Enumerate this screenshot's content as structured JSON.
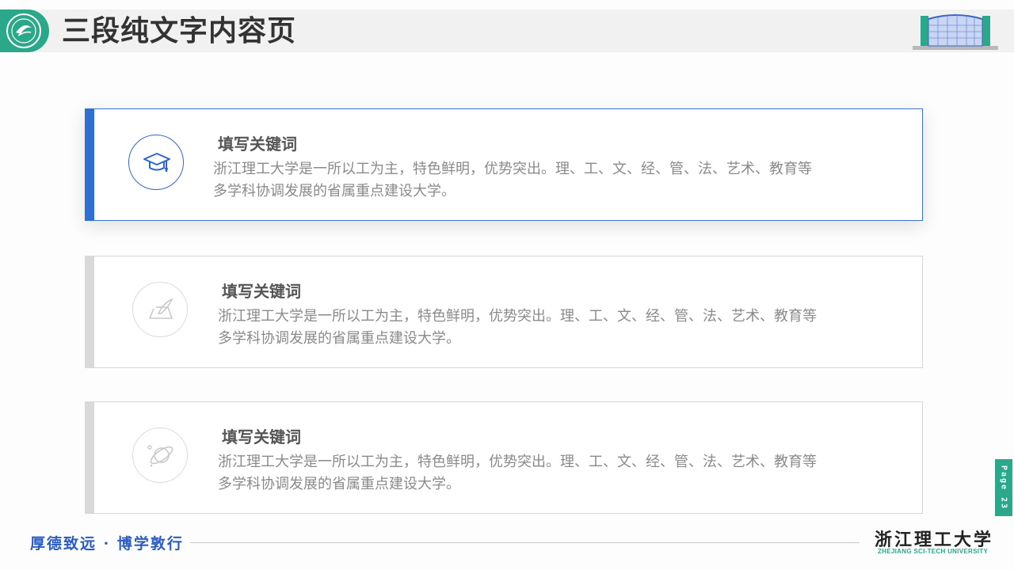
{
  "header": {
    "title": "三段纯文字内容页",
    "logo_icon": "university-seal-icon",
    "illustration_icon": "building-illustration-icon"
  },
  "cards": [
    {
      "title": "填写关键词",
      "desc_line1": "浙江理工大学是一所以工为主，特色鲜明，优势突出。理、工、文、经、管、法、艺术、教育等",
      "desc_line2": "多学科协调发展的省属重点建设大学。",
      "icon": "graduation-cap-icon",
      "active": true
    },
    {
      "title": "填写关键词",
      "desc_line1": "浙江理工大学是一所以工为主，特色鲜明，优势突出。理、工、文、经、管、法、艺术、教育等",
      "desc_line2": "多学科协调发展的省属重点建设大学。",
      "icon": "pen-paper-icon",
      "active": false
    },
    {
      "title": "填写关键词",
      "desc_line1": "浙江理工大学是一所以工为主，特色鲜明，优势突出。理、工、文、经、管、法、艺术、教育等",
      "desc_line2": "多学科协调发展的省属重点建设大学。",
      "icon": "planet-icon",
      "active": false
    }
  ],
  "page_tab": {
    "label": "Page 23"
  },
  "footer": {
    "motto": "厚德致远 · 博学敦行",
    "university_cn": "浙江理工大学",
    "university_en": "ZHEJIANG SCI-TECH UNIVERSITY"
  },
  "colors": {
    "brand_green": "#2aa889",
    "accent_blue": "#2f6fd4",
    "inactive_gray": "#d9d9d9"
  }
}
